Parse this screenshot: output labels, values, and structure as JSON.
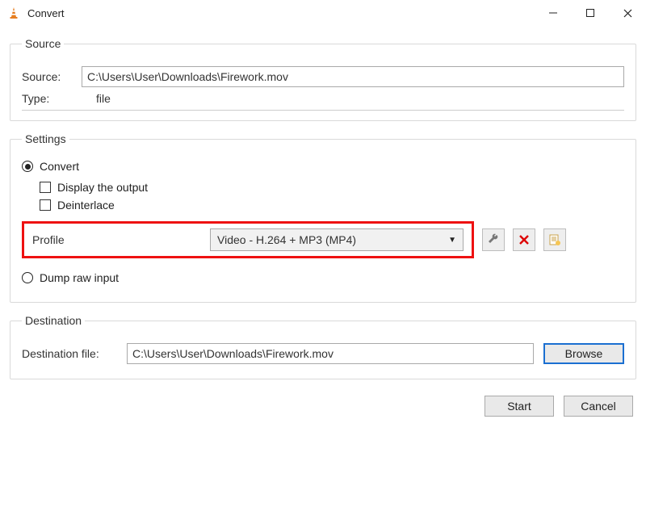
{
  "window": {
    "title": "Convert"
  },
  "source_group": {
    "legend": "Source",
    "source_label": "Source:",
    "source_value": "C:\\Users\\User\\Downloads\\Firework.mov",
    "type_label": "Type:",
    "type_value": "file"
  },
  "settings_group": {
    "legend": "Settings",
    "convert_label": "Convert",
    "convert_selected": true,
    "display_output_label": "Display the output",
    "display_output_checked": false,
    "deinterlace_label": "Deinterlace",
    "deinterlace_checked": false,
    "profile_label": "Profile",
    "profile_value": "Video - H.264 + MP3 (MP4)",
    "dump_raw_label": "Dump raw input",
    "dump_raw_selected": false
  },
  "destination_group": {
    "legend": "Destination",
    "dest_label": "Destination file:",
    "dest_value": "C:\\Users\\User\\Downloads\\Firework.mov",
    "browse_label": "Browse"
  },
  "buttons": {
    "start": "Start",
    "cancel": "Cancel"
  }
}
